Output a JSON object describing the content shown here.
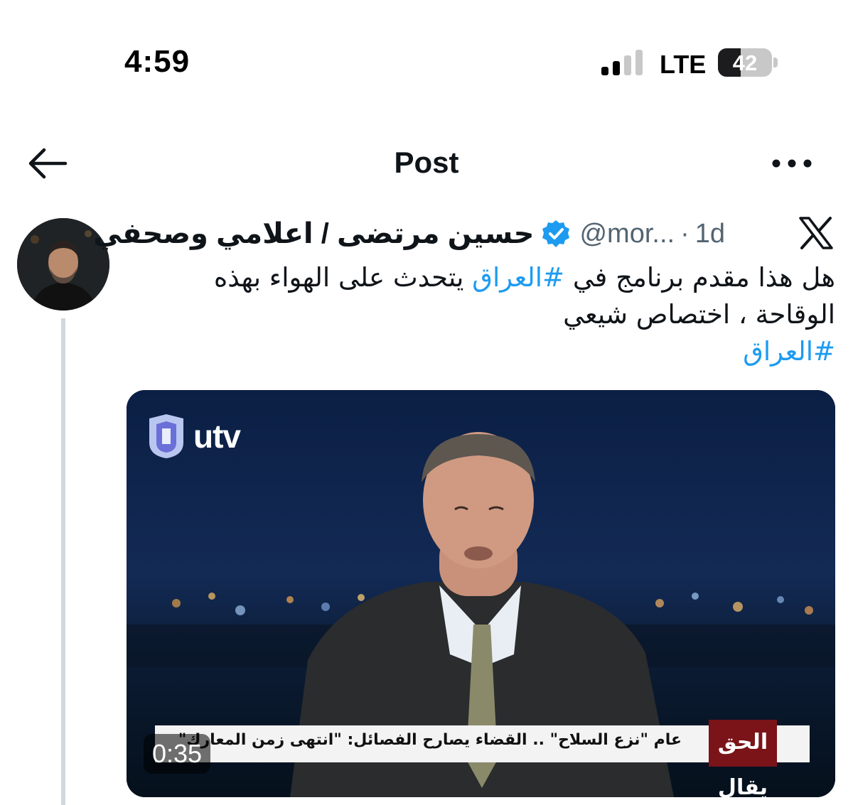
{
  "status_bar": {
    "time": "4:59",
    "network": "LTE",
    "battery": "42",
    "battery_level_percent": 42
  },
  "header": {
    "title": "Post"
  },
  "post": {
    "author_name": "حسين مرتضى / اعلامي وصحفي",
    "handle": "@mor...",
    "separator": "·",
    "time_ago": "1d",
    "body": {
      "part1": "هل هذا مقدم برنامج في ",
      "hashtag1": "#العراق",
      "part2": " يتحدث على الهواء بهذه الوقاحة ، اختصاص شيعي",
      "hashtag2": "#العراق"
    },
    "video": {
      "channel_logo": "utv",
      "ticker_text": "عام \"نزع السلاح\" .. القضاء يصارح الفصائل: \"انتهى زمن المعارك\"",
      "ticker_logo": "الحق يقال",
      "duration": "0:35"
    }
  },
  "colors": {
    "link": "#1d9bf0",
    "secondary_text": "#536471",
    "verified": "#1d9bf0",
    "thread_line": "#cfd9de"
  },
  "icons": {
    "back": "arrow-left-icon",
    "more": "more-horizontal-icon",
    "verified": "verified-badge-icon",
    "x": "x-logo-icon",
    "signal": "cellular-signal-icon",
    "battery": "battery-icon"
  }
}
